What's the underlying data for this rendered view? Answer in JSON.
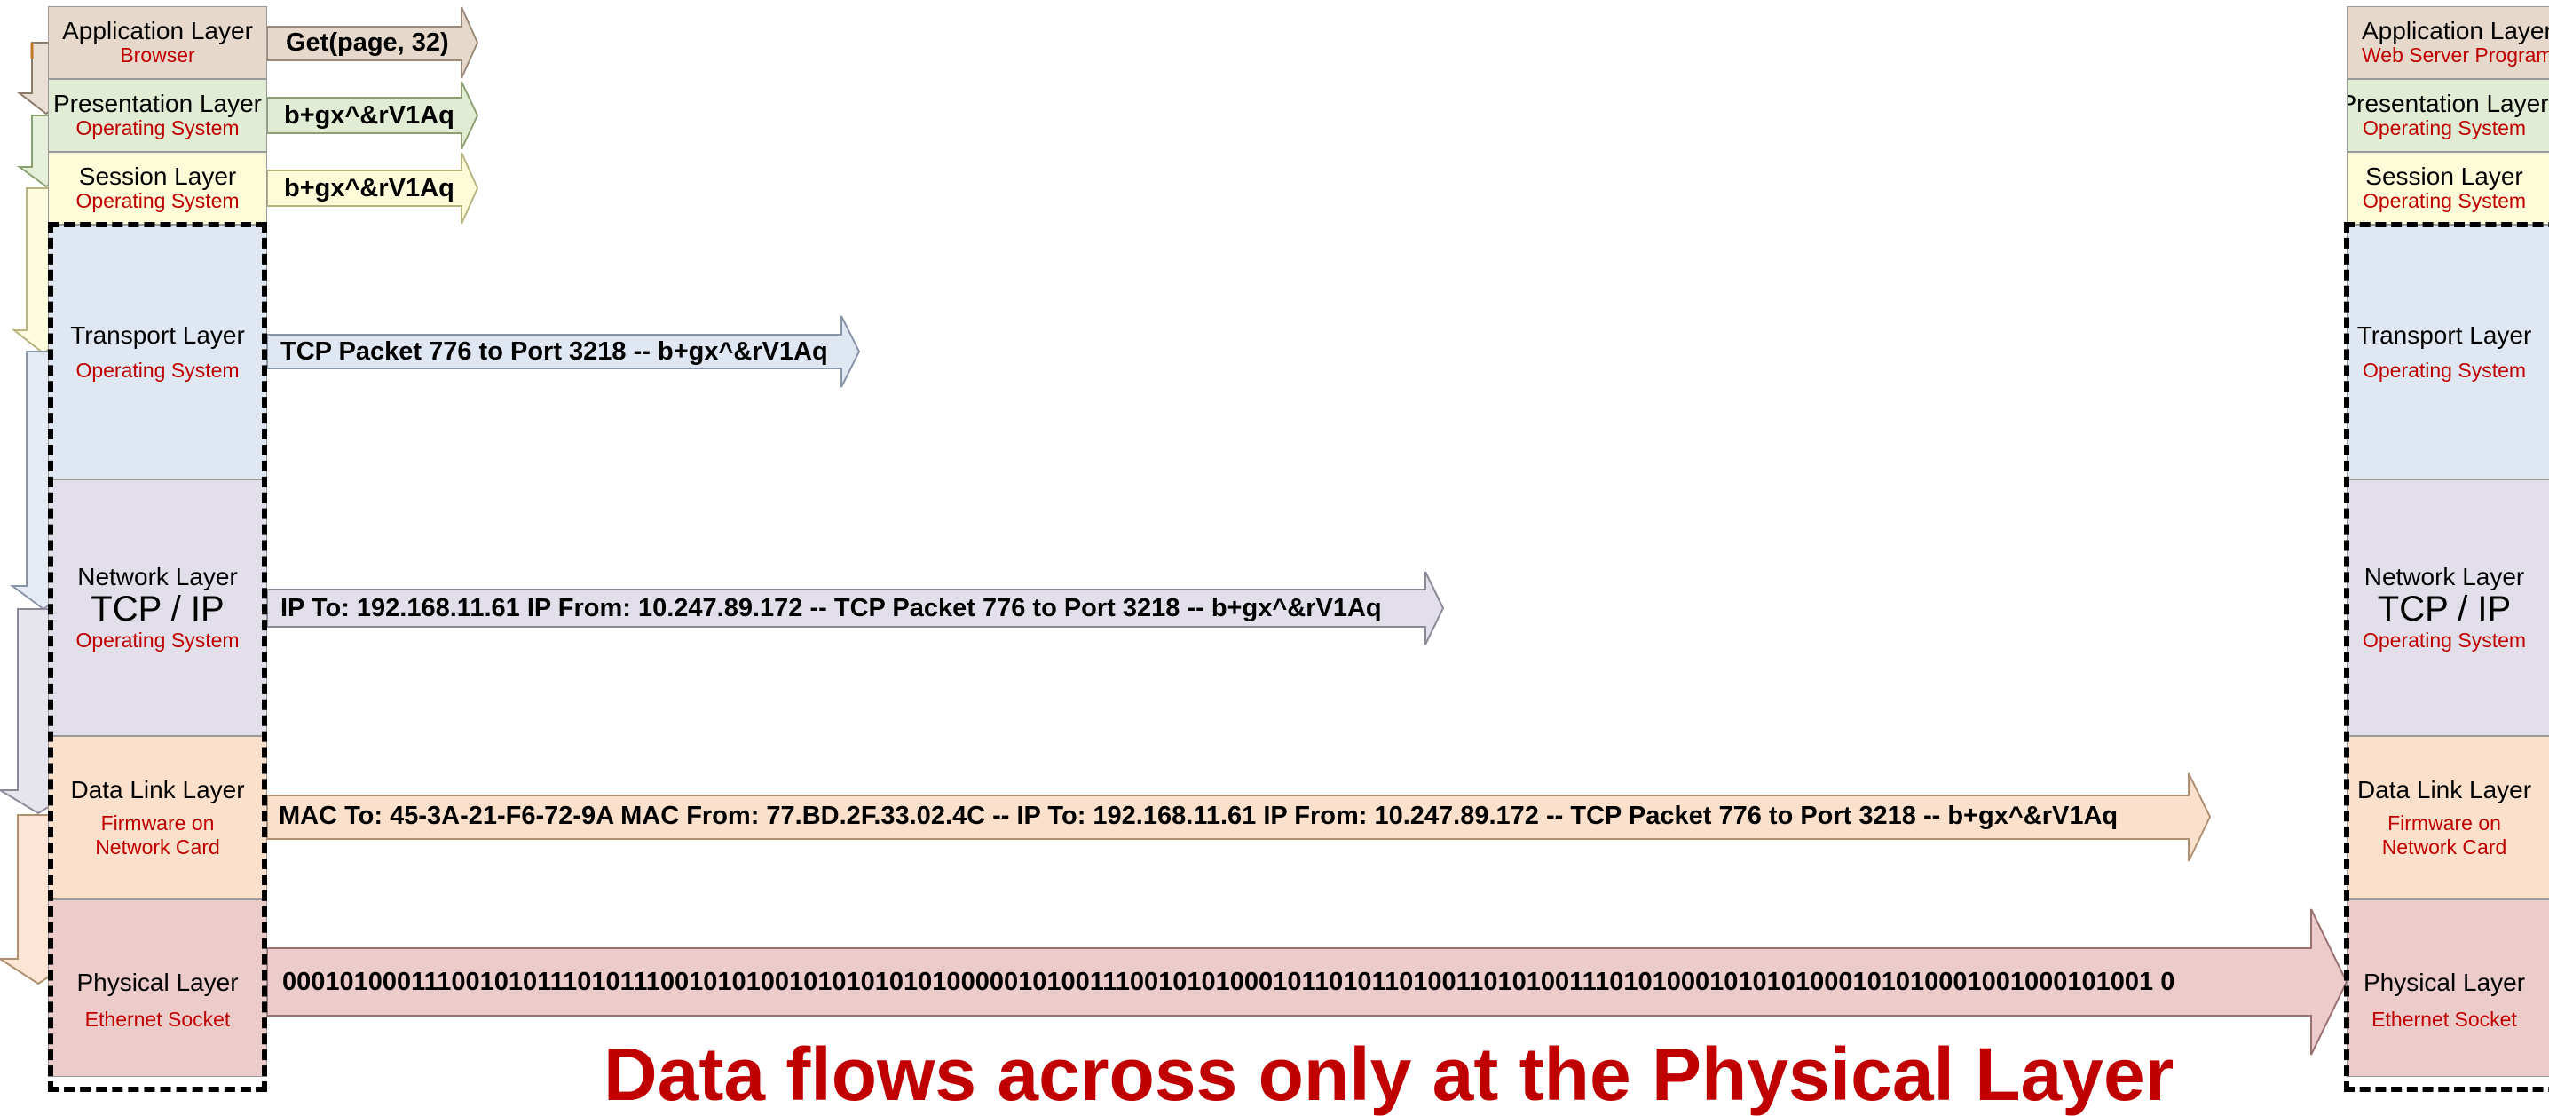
{
  "colors": {
    "application": "#e6d9cc",
    "presentation": "#e0ecd3",
    "session": "#fdfbd8",
    "transport": "#dfe7f3",
    "network": "#e2dfea",
    "datalink": "#fbe1cc",
    "physical": "#eccbcb",
    "label_red": "#c00000"
  },
  "left_stack": [
    {
      "name": "Application Layer",
      "sub": "Browser"
    },
    {
      "name": "Presentation Layer",
      "sub": "Operating System"
    },
    {
      "name": "Session Layer",
      "sub": "Operating System"
    },
    {
      "name": "Transport Layer",
      "sub": "Operating System"
    },
    {
      "name": "Network Layer",
      "proto": "TCP / IP",
      "sub": "Operating System"
    },
    {
      "name": "Data Link Layer",
      "sub": "Firmware on",
      "sub2": "Network Card"
    },
    {
      "name": "Physical Layer",
      "sub": "Ethernet Socket"
    }
  ],
  "right_stack": [
    {
      "name": "Application Layer",
      "sub": "Web  Server Program"
    },
    {
      "name": "Presentation Layer",
      "sub": "Operating System"
    },
    {
      "name": "Session Layer",
      "sub": "Operating System"
    },
    {
      "name": "Transport Layer",
      "sub": "Operating System"
    },
    {
      "name": "Network Layer",
      "proto": "TCP / IP",
      "sub": "Operating System"
    },
    {
      "name": "Data Link Layer",
      "sub": "Firmware on",
      "sub2": "Network Card"
    },
    {
      "name": "Physical Layer",
      "sub": "Ethernet Socket"
    }
  ],
  "messages": {
    "application": "Get(page, 32)",
    "presentation": "b+gx^&rV1Aq",
    "session": "b+gx^&rV1Aq",
    "transport": "TCP Packet 776 to Port 3218 -- b+gx^&rV1Aq",
    "network": "IP To: 192.168.11.61 IP From: 10.247.89.172 -- TCP Packet 776 to Port 3218 -- b+gx^&rV1Aq",
    "datalink": "MAC To: 45-3A-21-F6-72-9A MAC From: 77.BD.2F.33.02.4C -- IP To: 192.168.11.61 IP From: 10.247.89.172 -- TCP Packet 776 to Port 3218 -- b+gx^&rV1Aq",
    "physical": "000101000111001010111010111001010100101010101010000010100111001010100010110101101001101010011101010001010101000101010001001000101001 0"
  },
  "title": "Data flows across only at the Physical Layer"
}
